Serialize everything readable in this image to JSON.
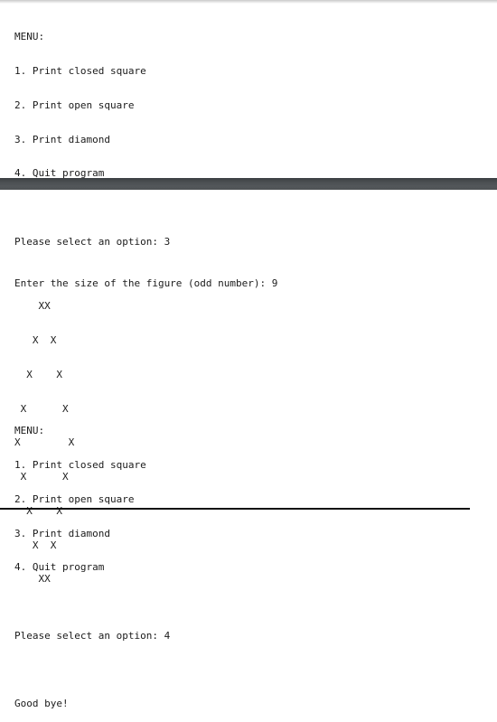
{
  "screen": {
    "type": "terminal-console-output",
    "background_color": "#ffffff",
    "text_color": "#1b1b1b",
    "divider_color": "#4b4f52",
    "rule_color": "#111111"
  },
  "session_top": {
    "menu_heading": "MENU:",
    "menu_options": [
      "1. Print closed square",
      "2. Print open square",
      "3. Print diamond",
      "4. Quit program"
    ],
    "prompt_label": "Please select an option: ",
    "prompt_value": "3",
    "prompt_line": "Please select an option: 3"
  },
  "session_bottom": {
    "size_prompt_label": "Enter the size of the figure (odd number): ",
    "size_prompt_value": "9",
    "size_prompt_line": "Enter the size of the figure (odd number): 9",
    "figure_name": "diamond",
    "figure_size": 9,
    "figure_char": "X",
    "figure_rows": [
      "    XX",
      "   X  X",
      "  X    X",
      " X      X",
      "X        X",
      " X      X",
      "  X    X",
      "   X  X",
      "    XX"
    ],
    "menu_heading": "MENU:",
    "menu_options": [
      "1. Print closed square",
      "2. Print open square",
      "3. Print diamond",
      "4. Quit program"
    ],
    "prompt_label": "Please select an option: ",
    "prompt_value": "4",
    "prompt_line": "Please select an option: 4",
    "farewell": "Good bye!"
  }
}
